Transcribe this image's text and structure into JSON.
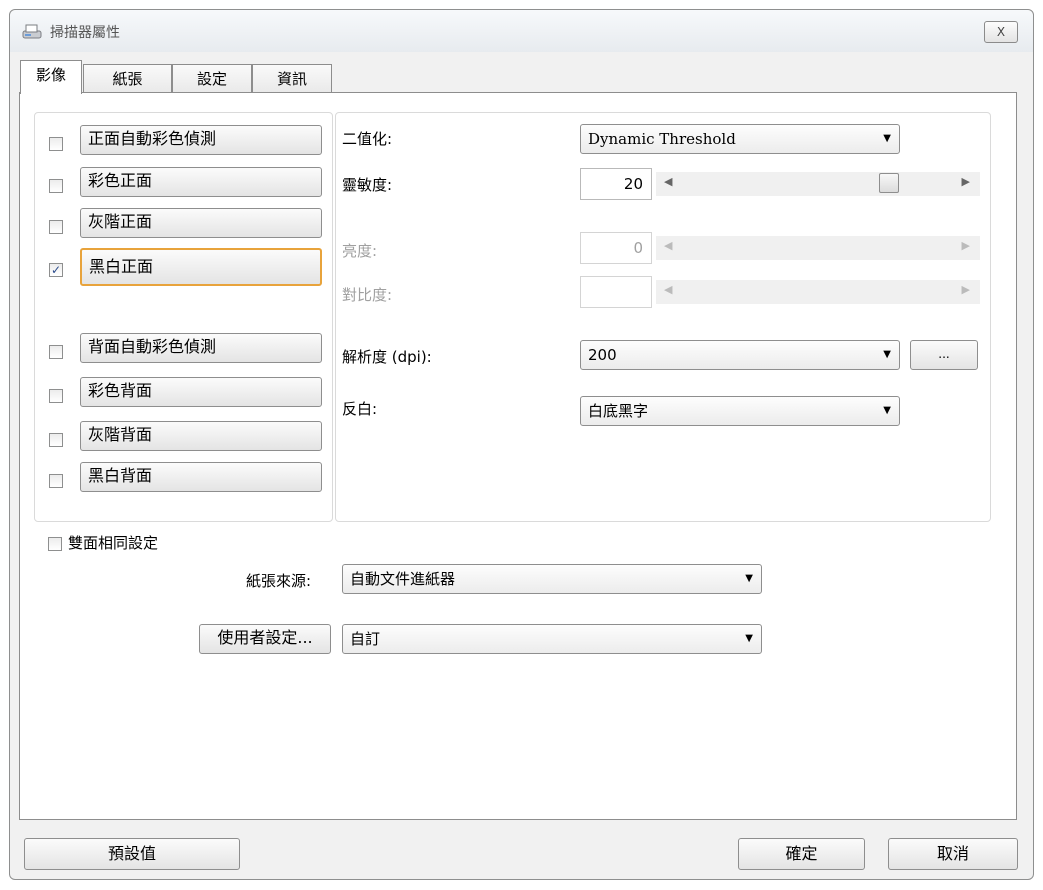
{
  "window": {
    "title": "掃描器屬性",
    "close_label": "X"
  },
  "tabs": [
    {
      "label": "影像"
    },
    {
      "label": "紙張"
    },
    {
      "label": "設定"
    },
    {
      "label": "資訊"
    }
  ],
  "image_modes": [
    {
      "label": "正面自動彩色偵測",
      "checked": false
    },
    {
      "label": "彩色正面",
      "checked": false
    },
    {
      "label": "灰階正面",
      "checked": false
    },
    {
      "label": "黑白正面",
      "checked": true
    },
    {
      "label": "背面自動彩色偵測",
      "checked": false
    },
    {
      "label": "彩色背面",
      "checked": false
    },
    {
      "label": "灰階背面",
      "checked": false
    },
    {
      "label": "黑白背面",
      "checked": false
    }
  ],
  "settings": {
    "binarization": {
      "label": "二值化:",
      "value": "Dynamic Threshold"
    },
    "sensitivity": {
      "label": "靈敏度:",
      "value": "20",
      "level": 0.73
    },
    "brightness": {
      "label": "亮度:",
      "value": "0"
    },
    "contrast": {
      "label": "對比度:",
      "value": ""
    },
    "resolution": {
      "label": "解析度 (dpi):",
      "value": "200",
      "more_label": "..."
    },
    "invert": {
      "label": "反白:",
      "value": "白底黑字"
    }
  },
  "duplex_same": {
    "label": "雙面相同設定",
    "checked": false
  },
  "paper_source": {
    "label": "紙張來源:",
    "value": "自動文件進紙器"
  },
  "user_settings": {
    "button_label": "使用者設定...",
    "value": "自訂"
  },
  "footer": {
    "default_label": "預設值",
    "ok_label": "確定",
    "cancel_label": "取消"
  }
}
